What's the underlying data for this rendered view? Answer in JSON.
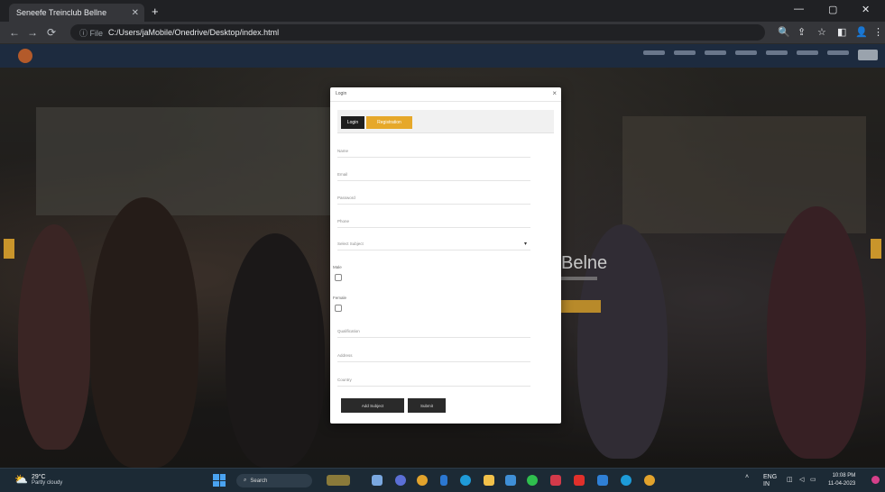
{
  "browser": {
    "tab_title": "Seneefe Treinclub Bellne",
    "tab_close": "✕",
    "new_tab": "+",
    "window_controls": [
      "—",
      "▢",
      "✕"
    ],
    "address": "C:/Users/jaMobile/Onedrive/Desktop/index.html",
    "address_prefix": "ⓘ File",
    "nav_icons": [
      "←",
      "→",
      "⟳"
    ],
    "toolbar_icons": [
      "🔍",
      "⇪",
      "☆",
      "◧",
      "👤",
      "⋮"
    ]
  },
  "hero": {
    "heading": "Belne"
  },
  "modal": {
    "title": "Login",
    "close": "×",
    "tabs": {
      "login": "Login",
      "register": "Registration"
    },
    "fields": {
      "name": "Name",
      "email": "Email",
      "password": "Password",
      "phone": "Phone",
      "select": "Select Subject"
    },
    "labels": {
      "male": "Male",
      "female": "Female"
    },
    "fields2": {
      "qualification": "Qualification",
      "address": "Address",
      "country": "Country"
    },
    "buttons": {
      "add_subject": "Add Subject",
      "submit": "Submit"
    },
    "caret": "▾"
  },
  "taskbar": {
    "weather_temp": "29°C",
    "weather_desc": "Partly cloudy",
    "search_label": "Search",
    "time": "10:08 PM",
    "date": "11-04-2023",
    "tray_lang": "ENG",
    "tray_region": "IN"
  }
}
